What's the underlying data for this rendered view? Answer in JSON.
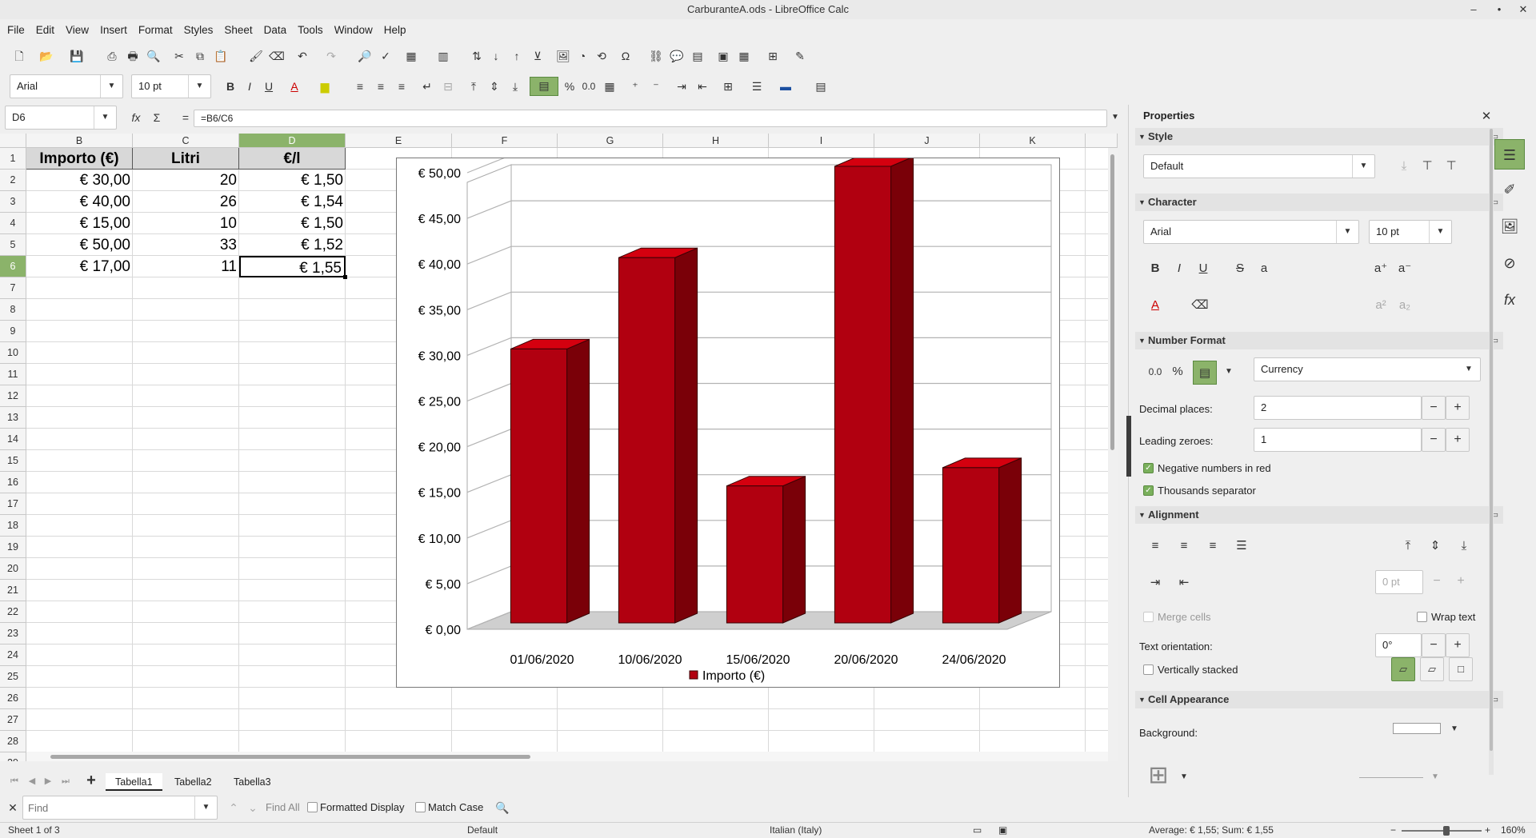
{
  "window": {
    "title": "CarburanteA.ods - LibreOffice Calc"
  },
  "menu": [
    "File",
    "Edit",
    "View",
    "Insert",
    "Format",
    "Styles",
    "Sheet",
    "Data",
    "Tools",
    "Window",
    "Help"
  ],
  "toolbar": {
    "font_name": "Arial",
    "font_size": "10 pt"
  },
  "formula_bar": {
    "cell_ref": "D6",
    "formula": "=B6/C6"
  },
  "columns": [
    "B",
    "C",
    "D",
    "E",
    "F",
    "G",
    "H",
    "I",
    "J",
    "K"
  ],
  "rows": [
    "1",
    "2",
    "3",
    "4",
    "5",
    "6",
    "7",
    "8",
    "9",
    "10",
    "11",
    "12",
    "13",
    "14",
    "15",
    "16",
    "17",
    "18",
    "19",
    "20",
    "21",
    "22",
    "23",
    "24",
    "25",
    "26",
    "27",
    "28",
    "29"
  ],
  "table": {
    "headers": [
      "Importo (€)",
      "Litri",
      "€/l"
    ],
    "rows": [
      [
        "€ 30,00",
        "20",
        "€ 1,50"
      ],
      [
        "€ 40,00",
        "26",
        "€ 1,54"
      ],
      [
        "€ 15,00",
        "10",
        "€ 1,50"
      ],
      [
        "€ 50,00",
        "33",
        "€ 1,52"
      ],
      [
        "€ 17,00",
        "11",
        "€ 1,55"
      ]
    ]
  },
  "chart_data": {
    "type": "bar",
    "categories": [
      "01/06/2020",
      "10/06/2020",
      "15/06/2020",
      "20/06/2020",
      "24/06/2020"
    ],
    "series": [
      {
        "name": "Importo (€)",
        "values": [
          30,
          40,
          15,
          50,
          17
        ],
        "color": "#b10010"
      }
    ],
    "yticks": [
      "€ 0,00",
      "€ 5,00",
      "€ 10,00",
      "€ 15,00",
      "€ 20,00",
      "€ 25,00",
      "€ 30,00",
      "€ 35,00",
      "€ 40,00",
      "€ 45,00",
      "€ 50,00"
    ],
    "ylim": [
      0,
      50
    ],
    "grid": true,
    "legend": "bottom",
    "style": "3d"
  },
  "sheet_tabs": [
    "Tabella1",
    "Tabella2",
    "Tabella3"
  ],
  "active_sheet": "Tabella1",
  "find_bar": {
    "placeholder": "Find",
    "find_all": "Find All",
    "formatted_display": "Formatted Display",
    "match_case": "Match Case"
  },
  "status": {
    "sheet": "Sheet 1 of 3",
    "page_style": "Default",
    "language": "Italian (Italy)",
    "summary": "Average: € 1,55; Sum: € 1,55",
    "zoom": "160%"
  },
  "sidebar": {
    "title": "Properties",
    "style": {
      "header": "Style",
      "value": "Default"
    },
    "character": {
      "header": "Character",
      "font": "Arial",
      "size": "10 pt"
    },
    "number_format": {
      "header": "Number Format",
      "format": "Currency",
      "decimal_label": "Decimal places:",
      "decimal_value": "2",
      "leading_label": "Leading zeroes:",
      "leading_value": "1",
      "neg_red": "Negative numbers in red",
      "thousands": "Thousands separator"
    },
    "alignment": {
      "header": "Alignment",
      "indent": "0 pt",
      "merge": "Merge cells",
      "wrap": "Wrap text",
      "orientation_label": "Text orientation:",
      "orientation_value": "0°",
      "vstacked": "Vertically stacked"
    },
    "cell_appearance": {
      "header": "Cell Appearance",
      "background": "Background:"
    }
  }
}
